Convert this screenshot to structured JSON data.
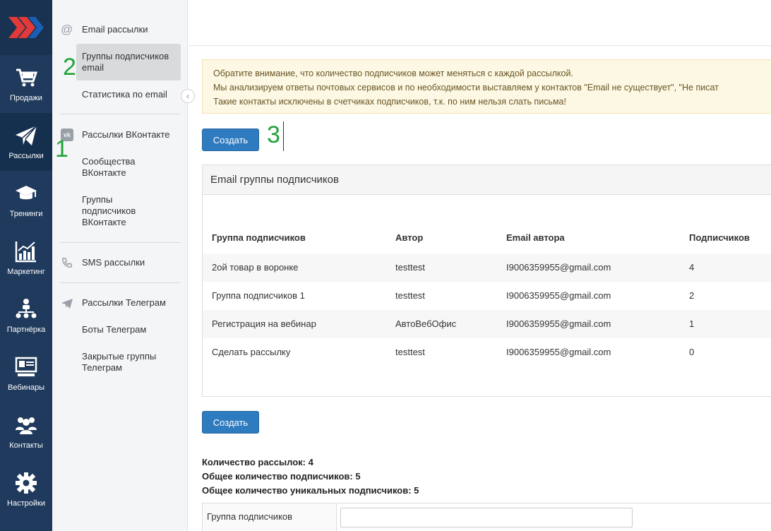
{
  "nav": {
    "items": [
      {
        "label": "Продажи",
        "icon": "cart-icon"
      },
      {
        "label": "Рассылки",
        "icon": "paper-plane-icon"
      },
      {
        "label": "Тренинги",
        "icon": "graduation-cap-icon"
      },
      {
        "label": "Маркетинг",
        "icon": "chart-icon"
      },
      {
        "label": "Партнёрка",
        "icon": "hierarchy-icon"
      },
      {
        "label": "Вебинары",
        "icon": "presentation-icon"
      },
      {
        "label": "Контакты",
        "icon": "users-icon"
      },
      {
        "label": "Настройки",
        "icon": "gear-icon"
      }
    ],
    "active_color": "#15304f",
    "bg_color": "#1f3a5c"
  },
  "sub": {
    "email": "Email рассылки",
    "email_groups": "Группы подписчиков email",
    "email_stats": "Статистика по email",
    "vk": "Рассылки ВКонтакте",
    "vk_communities": "Сообщества ВКонтакте",
    "vk_groups": "Группы подписчиков ВКонтакте",
    "sms": "SMS рассылки",
    "telegram": "Рассылки Телеграм",
    "telegram_bots": "Боты Телеграм",
    "telegram_closed": "Закрытые группы Телеграм"
  },
  "annotations": {
    "one": "1",
    "two": "2",
    "three": "3"
  },
  "alert": {
    "line1": "Обратите внимание, что количество подписчиков может меняться с каждой рассылкой.",
    "line2": "Мы анализируем ответы почтовых сервисов и по необходимости выставляем у контактов \"Email не существует\", \"Не писат",
    "line3": "Такие контакты исключены в счетчиках подписчиков, т.к. по ним нельзя слать письма!"
  },
  "buttons": {
    "create": "Создать"
  },
  "panel": {
    "title": "Email группы подписчиков",
    "columns": [
      "Группа подписчиков",
      "Автор",
      "Email автора",
      "Подписчиков"
    ],
    "rows": [
      [
        "2ой товар в воронке",
        "testtest",
        "I9006359955@gmail.com",
        "4"
      ],
      [
        "Группа подписчиков 1",
        "testtest",
        "I9006359955@gmail.com",
        "2"
      ],
      [
        "Регистрация на вебинар",
        "АвтоВебОфис",
        "I9006359955@gmail.com",
        "1"
      ],
      [
        "Сделать рассылку",
        "testtest",
        "I9006359955@gmail.com",
        "0"
      ]
    ]
  },
  "stats": {
    "mailings": "Количество рассылок: 4",
    "subscribers": "Общее количество подписчиков: 5",
    "unique": "Общее количество уникальных подписчиков: 5"
  },
  "filter": {
    "label": "Группа подписчиков",
    "value": ""
  }
}
